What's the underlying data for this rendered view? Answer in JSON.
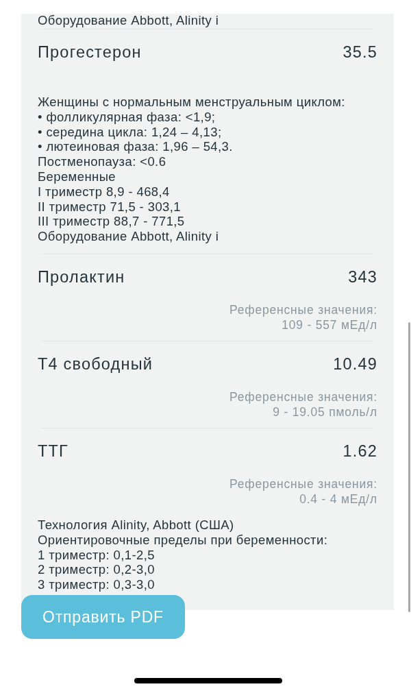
{
  "results": [
    {
      "note": [
        "Оборудование Abbott, Alinity i"
      ]
    },
    {
      "name": "Прогестерон",
      "value": "35.5",
      "note": [
        "Женщины с нормальным менструальным циклом:",
        "• фолликулярная фаза: <1,9;",
        "• середина цикла: 1,24 – 4,13;",
        "• лютеиновая фаза: 1,96 – 54,3.",
        "Постменопауза: <0.6",
        "Беременные",
        "I триместр 8,9 - 468,4",
        "II триместр 71,5 - 303,1",
        "III триместр 88,7 - 771,5",
        "Оборудование Abbott, Alinity i"
      ]
    },
    {
      "name": "Пролактин",
      "value": "343",
      "reference": [
        "Референсные значения:",
        "109 - 557 мЕд/л"
      ]
    },
    {
      "name": "Т4 свободный",
      "value": "10.49",
      "reference": [
        "Референсные значения:",
        "9 - 19.05 пмоль/л"
      ]
    },
    {
      "name": "ТТГ",
      "value": "1.62",
      "reference": [
        "Референсные значения:",
        "0.4 - 4 мЕд/л"
      ],
      "note": [
        "Технология Alinity, Abbott (США)",
        "Ориентировочные пределы при беременности:",
        "1 триместр: 0,1-2,5",
        "2 триместр: 0,2-3,0",
        "3 триместр: 0,3-3,0"
      ]
    }
  ],
  "send_button": {
    "label": "Отправить PDF"
  }
}
